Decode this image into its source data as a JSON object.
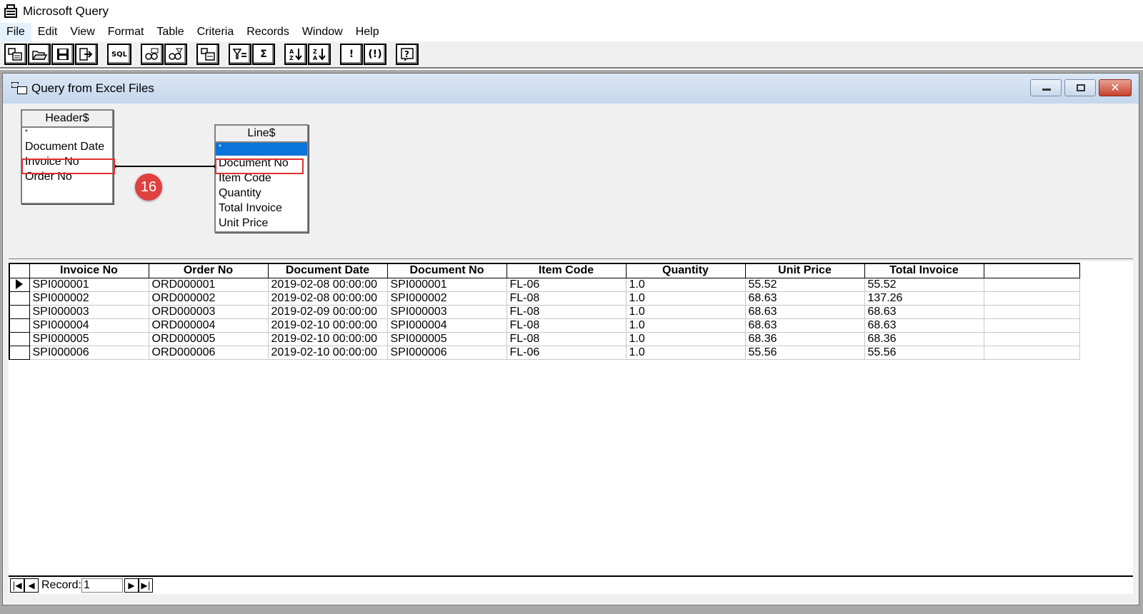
{
  "app": {
    "title": "Microsoft Query"
  },
  "menu": [
    "File",
    "Edit",
    "View",
    "Format",
    "Table",
    "Criteria",
    "Records",
    "Window",
    "Help"
  ],
  "toolbar": {
    "groups": [
      [
        "new-query-icon",
        "open-icon",
        "save-icon",
        "return-data-icon"
      ],
      [
        "sql-icon"
      ],
      [
        "show-tables-icon",
        "show-criteria-icon"
      ],
      [
        "add-tables-icon"
      ],
      [
        "criteria-equals-icon",
        "sum-icon"
      ],
      [
        "sort-ascending-icon",
        "sort-descending-icon"
      ],
      [
        "query-now-icon",
        "auto-query-icon"
      ],
      [
        "help-icon"
      ]
    ],
    "labels": {
      "sql": "SQL",
      "sum": "Σ",
      "query_now": "!",
      "auto_query": "(!)",
      "help": "?"
    }
  },
  "child_window": {
    "title": "Query from Excel Files"
  },
  "tables": {
    "header": {
      "name": "Header$",
      "fields": [
        "*",
        "Document Date",
        "Invoice No",
        "Order No"
      ]
    },
    "line": {
      "name": "Line$",
      "fields": [
        "*",
        "Document No",
        "Item Code",
        "Quantity",
        "Total Invoice",
        "Unit Price"
      ]
    }
  },
  "annotation": {
    "step": "16"
  },
  "grid": {
    "columns": [
      "Invoice No",
      "Order No",
      "Document Date",
      "Document No",
      "Item Code",
      "Quantity",
      "Unit Price",
      "Total Invoice"
    ],
    "rows": [
      [
        "SPI000001",
        "ORD000001",
        "2019-02-08 00:00:00",
        "SPI000001",
        "FL-06",
        "1.0",
        "55.52",
        "55.52"
      ],
      [
        "SPI000002",
        "ORD000002",
        "2019-02-08 00:00:00",
        "SPI000002",
        "FL-08",
        "1.0",
        "68.63",
        "137.26"
      ],
      [
        "SPI000003",
        "ORD000003",
        "2019-02-09 00:00:00",
        "SPI000003",
        "FL-08",
        "1.0",
        "68.63",
        "68.63"
      ],
      [
        "SPI000004",
        "ORD000004",
        "2019-02-10 00:00:00",
        "SPI000004",
        "FL-08",
        "1.0",
        "68.63",
        "68.63"
      ],
      [
        "SPI000005",
        "ORD000005",
        "2019-02-10 00:00:00",
        "SPI000005",
        "FL-08",
        "1.0",
        "68.36",
        "68.36"
      ],
      [
        "SPI000006",
        "ORD000006",
        "2019-02-10 00:00:00",
        "SPI000006",
        "FL-06",
        "1.0",
        "55.56",
        "55.56"
      ]
    ]
  },
  "record_nav": {
    "label": "Record:",
    "value": "1"
  },
  "colors": {
    "highlight": "#e03030",
    "selection": "#0a74da",
    "badge": "#e04040",
    "title_gradient": "#dbe7f5"
  }
}
